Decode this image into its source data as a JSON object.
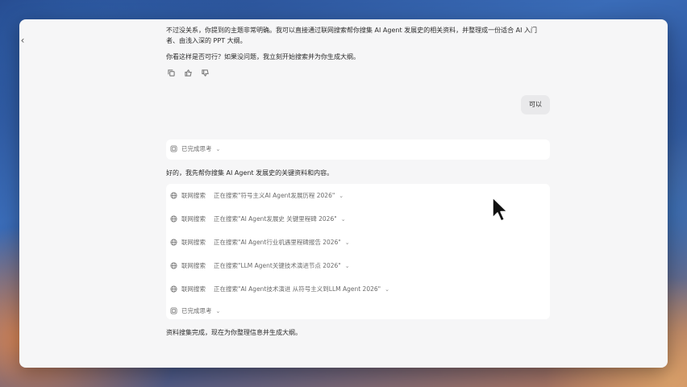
{
  "chat": {
    "assistant_intro_1": "不过没关系，你提到的主题非常明确。我可以直接通过联网搜索帮你搜集 AI Agent 发展史的相关资料，并整理成一份适合 AI 入门者、由浅入深的 PPT 大纲。",
    "assistant_intro_2": "你看这样是否可行？如果没问题，我立刻开始搜索并为你生成大纲。",
    "user_message": "可以",
    "thinking_label_1": "已完成思考",
    "assistant_reply": "好的，我先帮你搜集 AI Agent 发展史的关键资料和内容。",
    "searches": [
      {
        "kind": "联网搜索",
        "query": "正在搜索\"符号主义AI Agent发展历程 2026\""
      },
      {
        "kind": "联网搜索",
        "query": "正在搜索\"AI Agent发展史 关键里程碑 2026\""
      },
      {
        "kind": "联网搜索",
        "query": "正在搜索\"AI Agent行业机遇里程碑报告 2026\""
      },
      {
        "kind": "联网搜索",
        "query": "正在搜索\"LLM Agent关键技术演进节点 2026\""
      },
      {
        "kind": "联网搜索",
        "query": "正在搜索\"AI Agent技术演进 从符号主义到LLM Agent 2026\""
      }
    ],
    "thinking_label_2": "已完成思考",
    "assistant_final": "资料搜集完成，现在为你整理信息并生成大纲。"
  },
  "icons": {
    "back": "chevron-left-icon",
    "copy": "copy-icon",
    "like": "thumbs-up-icon",
    "dislike": "thumbs-down-icon",
    "thinking": "brain-icon",
    "search": "globe-icon",
    "expand": "chevron-down-icon",
    "cursor": "mouse-pointer-icon"
  },
  "colors": {
    "window_bg": "#f6f6f7",
    "card_bg": "#ffffff",
    "bubble_bg": "#e9e9eb"
  }
}
